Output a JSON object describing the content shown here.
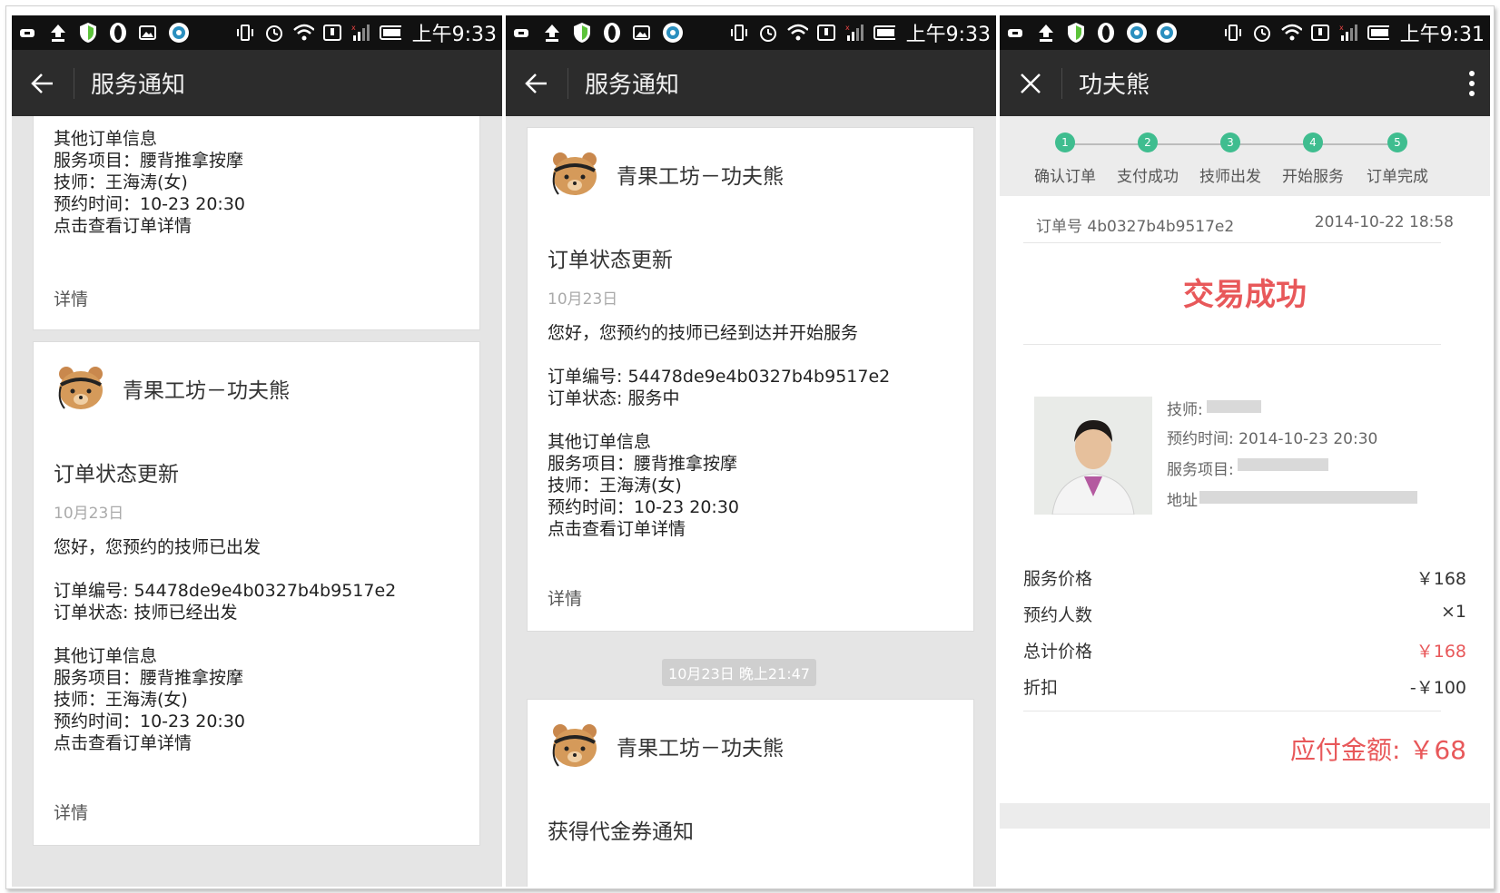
{
  "screens": [
    {
      "status_time": "上午9:33",
      "appbar_title": "服务通知",
      "card1_lines": [
        "其他订单信息",
        "服务项目：腰背推拿按摩",
        "技师：王海涛(女)",
        "预约时间：10-23 20:30",
        "点击查看订单详情"
      ],
      "card1_link": "详情",
      "card2": {
        "shop": "青果工坊－功夫熊",
        "title": "订单状态更新",
        "date": "10月23日",
        "greeting": "您好，您预约的技师已出发",
        "order_no": "订单编号: 54478de9e4b0327b4b9517e2",
        "order_status": "订单状态: 技师已经出发",
        "info_lines": [
          "其他订单信息",
          "服务项目：腰背推拿按摩",
          "技师：王海涛(女)",
          "预约时间：10-23 20:30",
          "点击查看订单详情"
        ],
        "link": "详情"
      }
    },
    {
      "status_time": "上午9:33",
      "appbar_title": "服务通知",
      "card1": {
        "shop": "青果工坊－功夫熊",
        "title": "订单状态更新",
        "date": "10月23日",
        "greeting": "您好，您预约的技师已经到达并开始服务",
        "order_no": "订单编号: 54478de9e4b0327b4b9517e2",
        "order_status": "订单状态: 服务中",
        "info_lines": [
          "其他订单信息",
          "服务项目：腰背推拿按摩",
          "技师：王海涛(女)",
          "预约时间：10-23 20:30",
          "点击查看订单详情"
        ],
        "link": "详情"
      },
      "time_chip": "10月23日 晚上21:47",
      "card2": {
        "shop": "青果工坊－功夫熊",
        "title": "获得代金券通知"
      }
    },
    {
      "status_time": "上午9:31",
      "appbar_title": "功夫熊",
      "steps": [
        {
          "num": "1",
          "label": "确认订单"
        },
        {
          "num": "2",
          "label": "支付成功"
        },
        {
          "num": "3",
          "label": "技师出发"
        },
        {
          "num": "4",
          "label": "开始服务"
        },
        {
          "num": "5",
          "label": "订单完成"
        }
      ],
      "order_label": "订单号 4b0327b4b9517e2",
      "order_datetime": "2014-10-22 18:58",
      "result": "交易成功",
      "tech_label": "技师:",
      "appointment_label": "预约时间: 2014-10-23 20:30",
      "service_label": "服务项目:",
      "address_label": "地址",
      "rows": [
        {
          "label": "服务价格",
          "value": "￥168",
          "highlight": false
        },
        {
          "label": "预约人数",
          "value": "×1",
          "highlight": false
        },
        {
          "label": "总计价格",
          "value": "￥168",
          "highlight": true
        },
        {
          "label": "折扣",
          "value": "-￥100",
          "highlight": false
        }
      ],
      "payable": "应付金额: ￥68"
    }
  ],
  "colors": {
    "statusbar": "#111111",
    "appbar": "#2c2c2c",
    "step_dot": "#3fbd8f",
    "accent_red": "#e8585a"
  },
  "icons": [
    "back-arrow-icon",
    "close-icon",
    "more-vert-icon",
    "wifi-icon",
    "battery-icon",
    "alarm-icon",
    "signal-icon"
  ]
}
